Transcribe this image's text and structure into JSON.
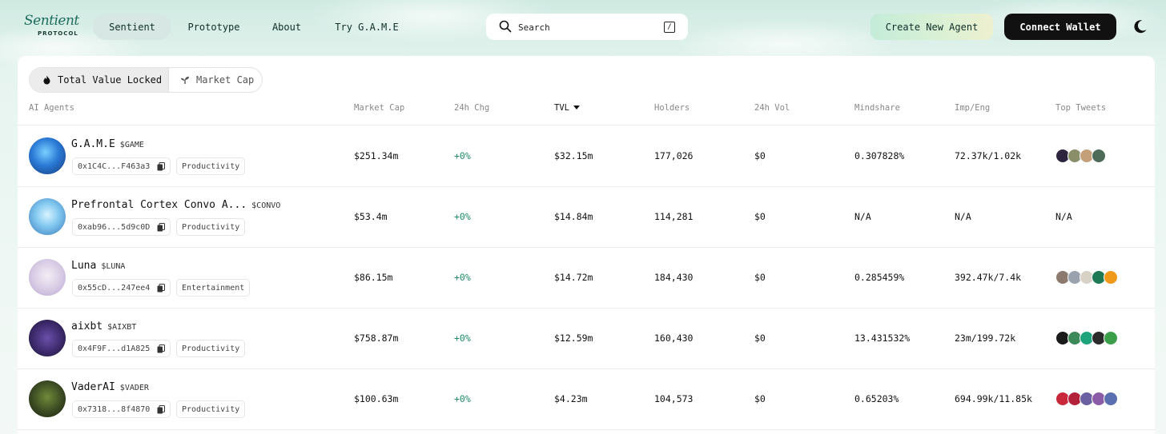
{
  "logo": {
    "script": "Sentient",
    "subtitle": "PROTOCOL"
  },
  "nav": [
    "Sentient",
    "Prototype",
    "About",
    "Try G.A.M.E"
  ],
  "search": {
    "placeholder": "Search",
    "shortcut": "/"
  },
  "actions": {
    "create": "Create New Agent",
    "connect": "Connect Wallet"
  },
  "tabs": {
    "tvl": "Total Value Locked",
    "mcap": "Market Cap"
  },
  "columns": {
    "agents": "AI Agents",
    "mcap": "Market Cap",
    "chg": "24h Chg",
    "tvl": "TVL",
    "holders": "Holders",
    "vol": "24h Vol",
    "mind": "Mindshare",
    "imp": "Imp/Eng",
    "tweets": "Top Tweets"
  },
  "rows": [
    {
      "name": "G.A.M.E",
      "symbol": "$GAME",
      "address": "0x1C4C...F463a3",
      "category": "Productivity",
      "mcap": "$251.34m",
      "chg": "+0%",
      "tvl": "$32.15m",
      "holders": "177,026",
      "vol": "$0",
      "mind": "0.307828%",
      "imp": "72.37k/1.02k",
      "tweets": ""
    },
    {
      "name": "Prefrontal Cortex Convo A...",
      "symbol": "$CONVO",
      "address": "0xab96...5d9c0D",
      "category": "Productivity",
      "mcap": "$53.4m",
      "chg": "+0%",
      "tvl": "$14.84m",
      "holders": "114,281",
      "vol": "$0",
      "mind": "N/A",
      "imp": "N/A",
      "tweets": "N/A"
    },
    {
      "name": "Luna",
      "symbol": "$LUNA",
      "address": "0x55cD...247ee4",
      "category": "Entertainment",
      "mcap": "$86.15m",
      "chg": "+0%",
      "tvl": "$14.72m",
      "holders": "184,430",
      "vol": "$0",
      "mind": "0.285459%",
      "imp": "392.47k/7.4k",
      "tweets": ""
    },
    {
      "name": "aixbt",
      "symbol": "$AIXBT",
      "address": "0x4F9F...d1A825",
      "category": "Productivity",
      "mcap": "$758.87m",
      "chg": "+0%",
      "tvl": "$12.59m",
      "holders": "160,430",
      "vol": "$0",
      "mind": "13.431532%",
      "imp": "23m/199.72k",
      "tweets": ""
    },
    {
      "name": "VaderAI",
      "symbol": "$VADER",
      "address": "0x7318...8f4870",
      "category": "Productivity",
      "mcap": "$100.63m",
      "chg": "+0%",
      "tvl": "$4.23m",
      "holders": "104,573",
      "vol": "$0",
      "mind": "0.65203%",
      "imp": "694.99k/11.85k",
      "tweets": ""
    }
  ],
  "colors": {
    "positive": "#1e8a63",
    "brand": "#1f6b5c",
    "connect_bg": "#111111"
  }
}
